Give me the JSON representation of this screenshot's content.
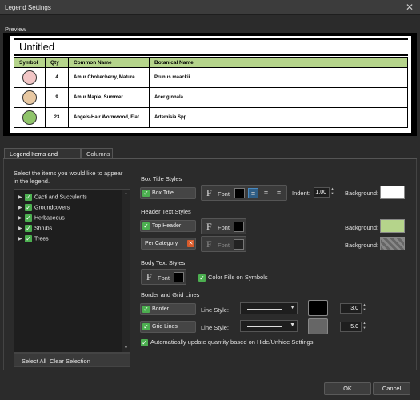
{
  "window": {
    "title": "Legend Settings"
  },
  "preview": {
    "section_label": "Preview",
    "title": "Untitled",
    "columns": [
      "Symbol",
      "Qty",
      "Common Name",
      "Botanical Name"
    ],
    "rows": [
      {
        "qty": "4",
        "common": "Amur Chokecherry, Mature",
        "botanical": "Prunus maackii",
        "symbol_color": "#f2c6c6"
      },
      {
        "qty": "9",
        "common": "Amur Maple, Summer",
        "botanical": "Acer ginnala",
        "symbol_color": "#e8c8a2"
      },
      {
        "qty": "23",
        "common": "Angels-Hair Wormwood, Flat",
        "botanical": "Artemisia Spp",
        "symbol_color": "#8fc46a"
      }
    ]
  },
  "tabs": [
    "Legend Items and Styles",
    "Columns"
  ],
  "items": {
    "instruction": "Select the items you would like to appear in the legend.",
    "instruction_line1": "Select the items you would like to appear",
    "instruction_line2": "in the legend.",
    "tree": [
      "Cacti and Succulents",
      "Groundcovers",
      "Herbaceous",
      "Shrubs",
      "Trees"
    ],
    "select_all": "Select All",
    "clear_selection": "Clear Selection"
  },
  "box_title": {
    "heading": "Box Title Styles",
    "toggle_label": "Box Title",
    "font_label": "Font",
    "indent_label": "Indent:",
    "indent_value": "1.00",
    "background_label": "Background:",
    "background_color": "#ffffff"
  },
  "header_text": {
    "heading": "Header Text Styles",
    "top_header_label": "Top Header",
    "font_label": "Font",
    "background_label": "Background:",
    "background_color": "#b5d48b",
    "per_category_label": "Per Category",
    "per_category_font_label": "Font",
    "per_category_background_label": "Background:"
  },
  "body_text": {
    "heading": "Body Text Styles",
    "font_label": "Font",
    "color_fills_label": "Color Fills on Symbols"
  },
  "border_grid": {
    "heading": "Border and Grid Lines",
    "border_label": "Border",
    "border_line_style_label": "Line Style:",
    "border_width": "3.0",
    "border_color": "#000000",
    "grid_label": "Grid Lines",
    "grid_line_style_label": "Line Style:",
    "grid_width": "5.0",
    "grid_color": "#666666",
    "auto_update_label": "Automatically update quantity based on Hide/Unhide Settings"
  },
  "footer": {
    "ok": "OK",
    "cancel": "Cancel"
  }
}
